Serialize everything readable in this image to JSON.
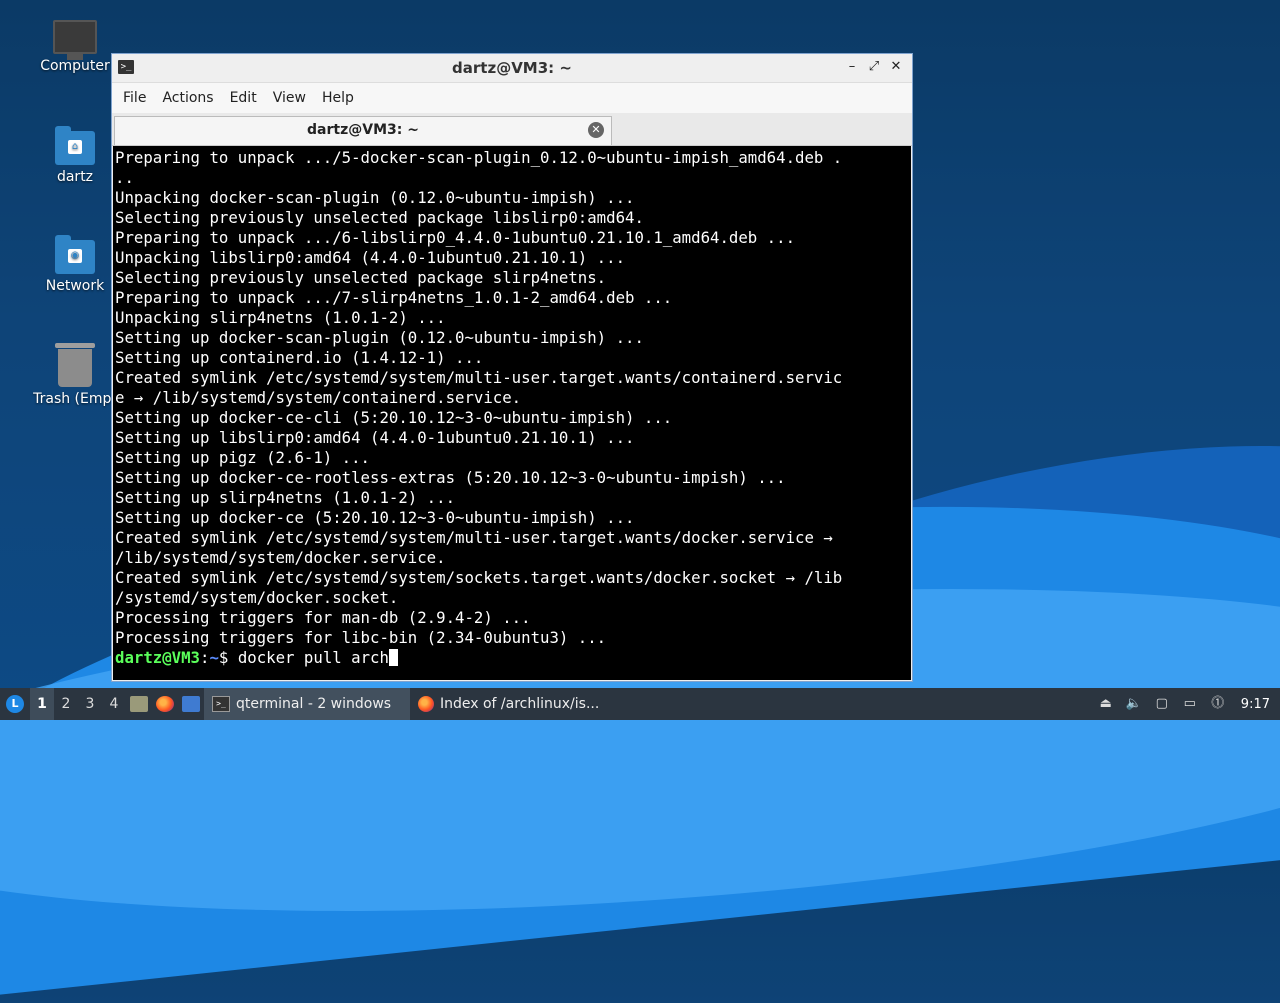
{
  "desktop": {
    "icons": [
      {
        "label": "Computer"
      },
      {
        "label": "dartz"
      },
      {
        "label": "Network"
      },
      {
        "label": "Trash (Empt"
      }
    ]
  },
  "window": {
    "title": "dartz@VM3: ~",
    "controls": {
      "minimize": "–",
      "maximize": "⤢",
      "close": "✕"
    },
    "menus": [
      "File",
      "Actions",
      "Edit",
      "View",
      "Help"
    ],
    "tab_title": "dartz@VM3: ~",
    "tab_close": "✕"
  },
  "terminal": {
    "lines": [
      "Preparing to unpack .../5-docker-scan-plugin_0.12.0~ubuntu-impish_amd64.deb .",
      "..",
      "Unpacking docker-scan-plugin (0.12.0~ubuntu-impish) ...",
      "Selecting previously unselected package libslirp0:amd64.",
      "Preparing to unpack .../6-libslirp0_4.4.0-1ubuntu0.21.10.1_amd64.deb ...",
      "Unpacking libslirp0:amd64 (4.4.0-1ubuntu0.21.10.1) ...",
      "Selecting previously unselected package slirp4netns.",
      "Preparing to unpack .../7-slirp4netns_1.0.1-2_amd64.deb ...",
      "Unpacking slirp4netns (1.0.1-2) ...",
      "Setting up docker-scan-plugin (0.12.0~ubuntu-impish) ...",
      "Setting up containerd.io (1.4.12-1) ...",
      "Created symlink /etc/systemd/system/multi-user.target.wants/containerd.servic",
      "e → /lib/systemd/system/containerd.service.",
      "Setting up docker-ce-cli (5:20.10.12~3-0~ubuntu-impish) ...",
      "Setting up libslirp0:amd64 (4.4.0-1ubuntu0.21.10.1) ...",
      "Setting up pigz (2.6-1) ...",
      "Setting up docker-ce-rootless-extras (5:20.10.12~3-0~ubuntu-impish) ...",
      "Setting up slirp4netns (1.0.1-2) ...",
      "Setting up docker-ce (5:20.10.12~3-0~ubuntu-impish) ...",
      "Created symlink /etc/systemd/system/multi-user.target.wants/docker.service →",
      "/lib/systemd/system/docker.service.",
      "Created symlink /etc/systemd/system/sockets.target.wants/docker.socket → /lib",
      "/systemd/system/docker.socket.",
      "Processing triggers for man-db (2.9.4-2) ...",
      "Processing triggers for libc-bin (2.34-0ubuntu3) ..."
    ],
    "prompt_user": "dartz@VM3",
    "prompt_sep": ":",
    "prompt_path": "~",
    "prompt_symbol": "$ ",
    "command": "docker pull arch"
  },
  "taskbar": {
    "start_icon": "start-menu-icon",
    "workspaces": [
      "1",
      "2",
      "3",
      "4"
    ],
    "active_workspace": "1",
    "tasks": [
      {
        "label": "qterminal - 2 windows",
        "icon": "terminal-icon"
      },
      {
        "label": "Index of /archlinux/is...",
        "icon": "firefox-icon"
      }
    ],
    "clock": "9:17"
  },
  "colors": {
    "prompt_user": "#5bff5b",
    "prompt_path": "#5b8cff",
    "terminal_bg": "#000000",
    "taskbar_bg": "#2b3540"
  }
}
